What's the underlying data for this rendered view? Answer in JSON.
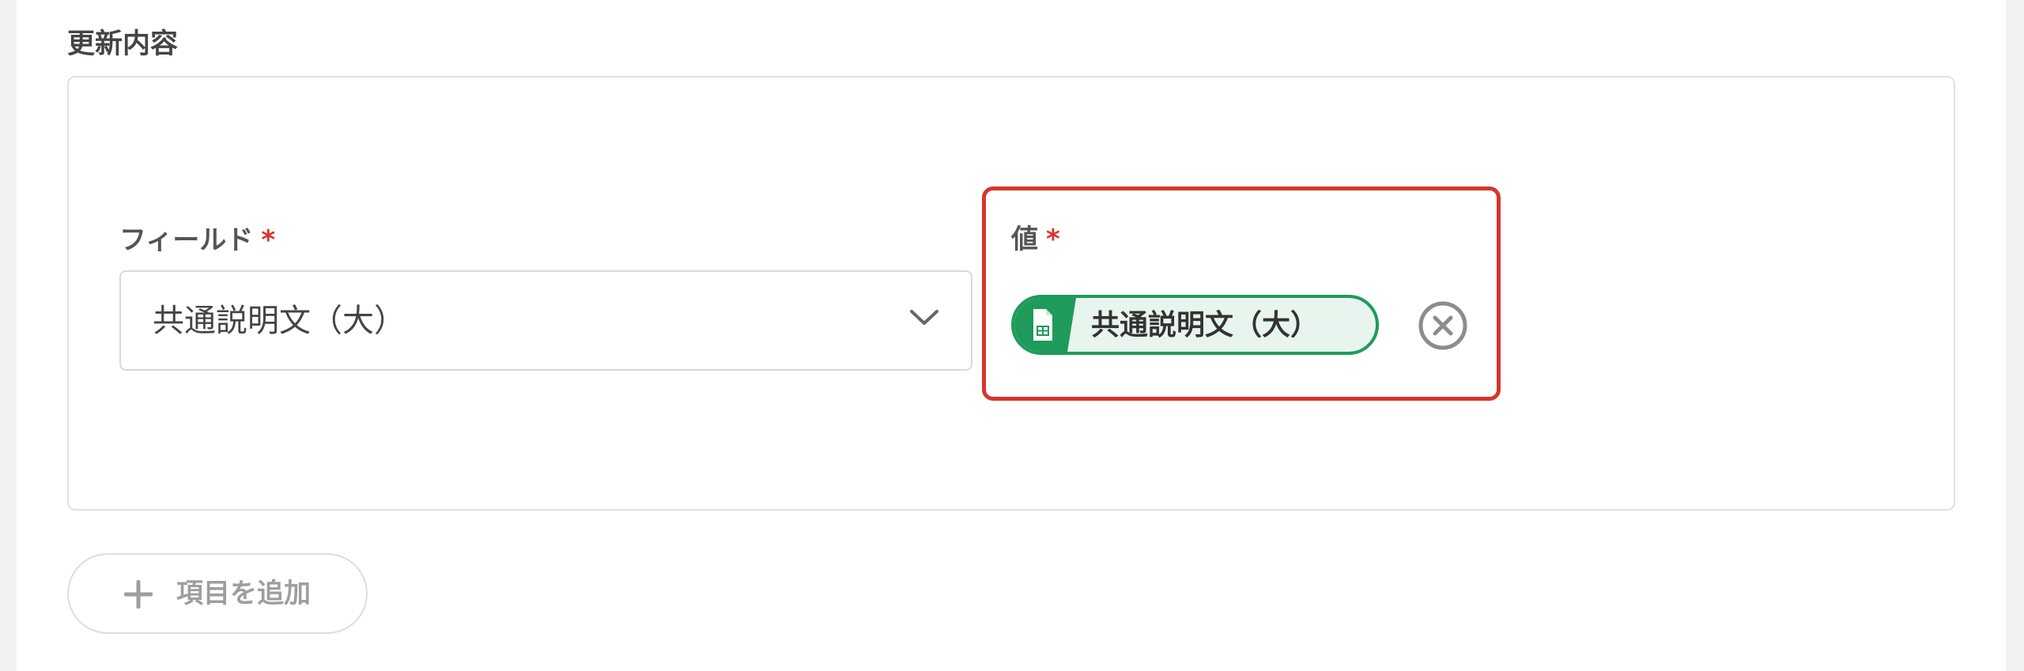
{
  "section": {
    "title": "更新内容"
  },
  "field": {
    "label": "フィールド",
    "required_mark": "*",
    "selected_value": "共通説明文（大）"
  },
  "value": {
    "label": "値",
    "required_mark": "*",
    "chip_label": "共通説明文（大）",
    "chip_icon": "spreadsheet-icon",
    "clear_icon": "clear-circle-icon"
  },
  "actions": {
    "add_item_label": "項目を追加",
    "add_icon": "plus-icon"
  },
  "colors": {
    "highlight_border": "#d9342b",
    "chip_accent": "#1e9b5a",
    "chip_background": "#e8f5ee",
    "required": "#d9342b"
  }
}
